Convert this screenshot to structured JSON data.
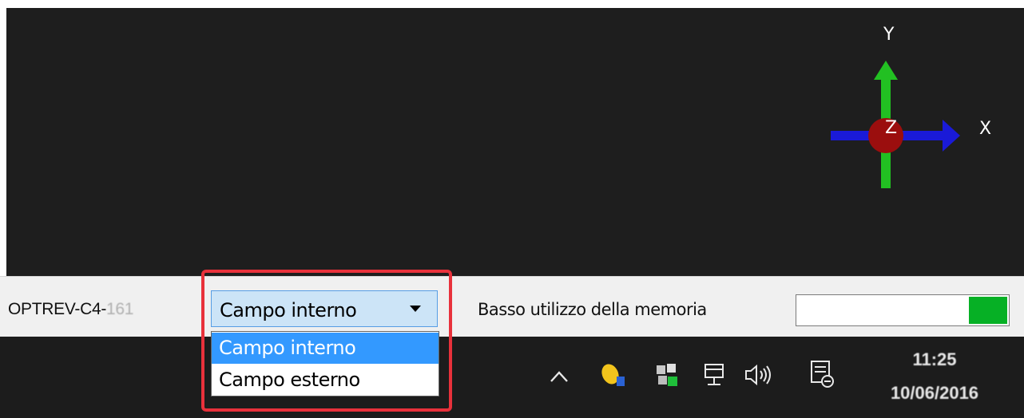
{
  "viewport": {
    "axes": {
      "y_label": "Y",
      "x_label": "X",
      "z_label": "Z"
    }
  },
  "statusbar": {
    "machine_name_prefix": "OPTREV-C4-",
    "machine_name_suffix": "161",
    "field_combo": {
      "selected": "Campo interno",
      "options": [
        "Campo interno",
        "Campo esterno"
      ]
    },
    "memory_label": "Basso utilizzo della memoria",
    "memory_usage_fraction": 0.18,
    "memory_color": "#06b025"
  },
  "taskbar": {
    "time": "11:25",
    "date": "10/06/2016",
    "tray_icons": [
      "chevron-up-icon",
      "lemon-app-icon",
      "puzzle-app-icon",
      "network-icon",
      "volume-icon",
      "notification-icon"
    ]
  }
}
